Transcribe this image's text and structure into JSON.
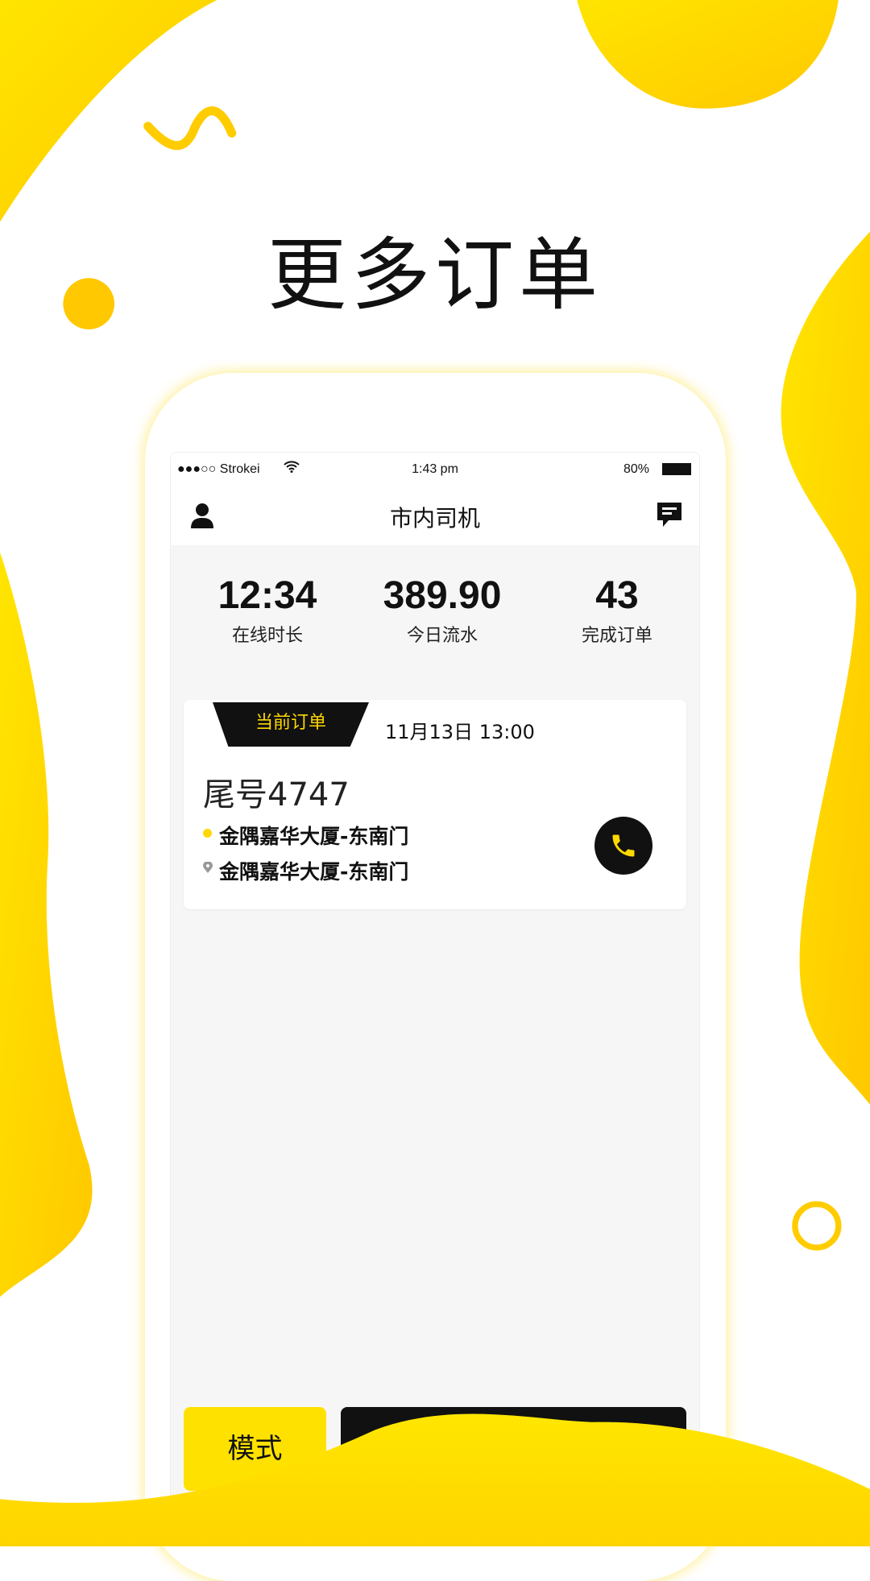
{
  "headline": "更多订单",
  "status_bar": {
    "carrier": "●●●○○ Strokei",
    "time": "1:43 pm",
    "battery": "80%"
  },
  "nav": {
    "title": "市内司机",
    "left_icon": "user-icon",
    "right_icon": "message-icon"
  },
  "stats": [
    {
      "value": "12:34",
      "label": "在线时长"
    },
    {
      "value": "389.90",
      "label": "今日流水"
    },
    {
      "value": "43",
      "label": "完成订单"
    }
  ],
  "order": {
    "tag": "当前订单",
    "datetime": "11月13日 13:00",
    "plate": "尾号4747",
    "from": "金隅嘉华大厦-东南门",
    "to": "金隅嘉华大厦-东南门"
  },
  "buttons": {
    "mode": "模式"
  },
  "colors": {
    "accent": "#ffe100",
    "dark": "#111111"
  }
}
